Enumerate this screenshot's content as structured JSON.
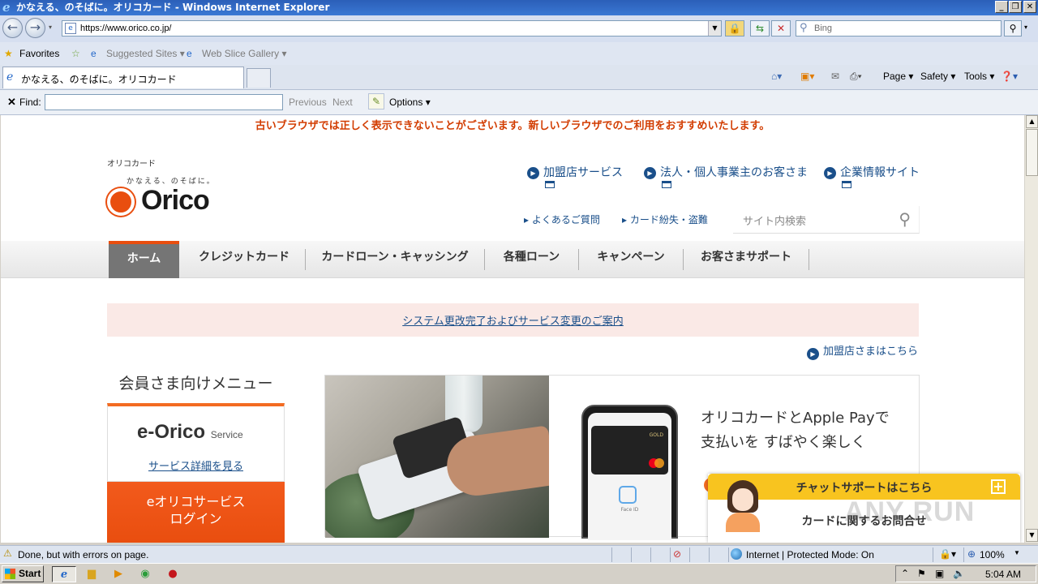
{
  "window": {
    "title": "かなえる、のそばに。オリコカード - Windows Internet Explorer"
  },
  "addressbar": {
    "url": "https://www.orico.co.jp/",
    "search_placeholder": "Bing"
  },
  "favorites_bar": {
    "favorites_label": "Favorites",
    "suggested_sites": "Suggested Sites ▾",
    "web_slice_gallery": "Web Slice Gallery ▾"
  },
  "tabs": [
    {
      "label": "かなえる、のそばに。オリコカード"
    }
  ],
  "command_bar": {
    "page": "Page ▾",
    "safety": "Safety ▾",
    "tools": "Tools ▾"
  },
  "find_bar": {
    "label": "Find:",
    "previous": "Previous",
    "next": "Next",
    "options": "Options ▾"
  },
  "page": {
    "browser_warning": "古いブラウザでは正しく表示できないことがございます。新しいブラウザでのご利用をおすすめいたします。",
    "brand_small": "オリコカード",
    "tagline": "かなえる、のそばに。",
    "logo_text": "Orico",
    "top_links": [
      {
        "label": "加盟店サービス"
      },
      {
        "label": "法人・個人事業主のお客さま"
      },
      {
        "label": "企業情報サイト"
      }
    ],
    "sub_links": [
      {
        "label": "よくあるご質問"
      },
      {
        "label": "カード紛失・盗難"
      }
    ],
    "site_search_placeholder": "サイト内検索",
    "nav": [
      {
        "label": "ホーム",
        "active": true
      },
      {
        "label": "クレジットカード"
      },
      {
        "label": "カードローン・キャッシング"
      },
      {
        "label": "各種ローン"
      },
      {
        "label": "キャンペーン"
      },
      {
        "label": "お客さまサポート"
      }
    ],
    "notice_link": "システム更改完了およびサービス変更のご案内",
    "merchant_link": "加盟店さまはこちら",
    "member_menu_title": "会員さま向けメニュー",
    "eorico": {
      "logo": "e-Orico",
      "service": "Service",
      "details_link": "サービス詳細を見る",
      "login_line1": "eオリコサービス",
      "login_line2": "ログイン"
    },
    "banner": {
      "line1": "オリコカードとApple Payで",
      "line2": "支払いを すばやく楽しく",
      "phone_gold": "GOLD",
      "faceid_label": "Face ID"
    },
    "chat": {
      "header": "チャットサポートはこちら",
      "question": "カードに関するお問合せ"
    }
  },
  "statusbar": {
    "message": "Done, but with errors on page.",
    "zone": "Internet | Protected Mode: On",
    "zoom": "100%"
  },
  "taskbar": {
    "start": "Start",
    "time": "5:04 AM"
  },
  "watermark": "ANY RUN",
  "colors": {
    "brand_orange": "#e94e0f",
    "link_blue": "#1a4f8a",
    "warning_red": "#d23c00",
    "chat_yellow": "#f8c41f"
  }
}
